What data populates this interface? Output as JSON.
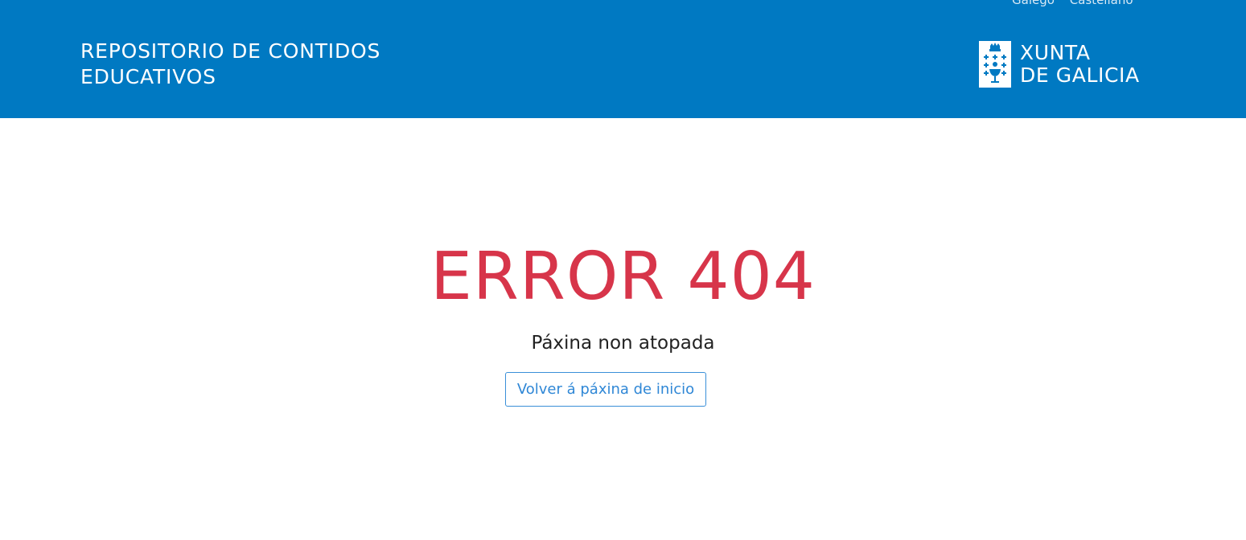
{
  "header": {
    "languages": [
      "Galego",
      "Castellano"
    ],
    "site_title_line1": "Repositorio de contidos",
    "site_title_line2": "educativos",
    "logo": {
      "icon": "xunta-coat-of-arms-icon",
      "line1": "XUNTA",
      "line2": "DE GALICIA"
    },
    "background_color": "#0079c2"
  },
  "main": {
    "error_title": "ERROR 404",
    "error_message": "Páxina non atopada",
    "home_button_label": "Volver á páxina de inicio",
    "error_color": "#d7354a",
    "button_color": "#2f87d6"
  }
}
